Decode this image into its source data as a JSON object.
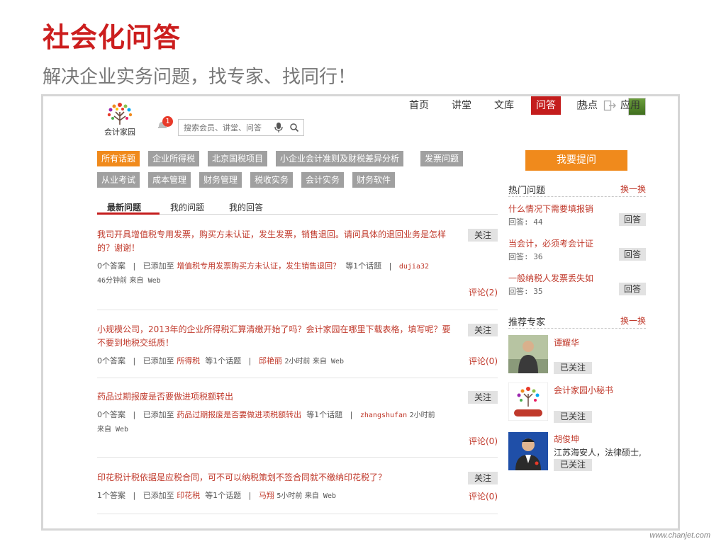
{
  "slide": {
    "title": "社会化问答",
    "subtitle": "解决企业实务问题，找专家、找同行！",
    "footer_url": "www.chanjet.com"
  },
  "header": {
    "logo_text": "会计家园",
    "notification_count": "1",
    "search_placeholder": "搜索会员、讲堂、问答",
    "nav": [
      "首页",
      "讲堂",
      "文库",
      "问答",
      "热点",
      "应用"
    ],
    "active_nav": "问答"
  },
  "topic_tags": {
    "row1": [
      "所有话题",
      "企业所得税",
      "北京国税项目",
      "小企业会计准则及财税差异分析",
      "发票问题"
    ],
    "row2": [
      "从业考试",
      "成本管理",
      "财务管理",
      "税收实务",
      "会计实务",
      "财务软件"
    ],
    "active": "所有话题"
  },
  "tabs": [
    "最新问题",
    "我的问题",
    "我的回答"
  ],
  "questions": [
    {
      "title": "我司开具增值税专用发票，购买方未认证，发生发票，销售退回。请问具体的退回业务是怎样的？谢谢！",
      "follow": "关注",
      "answers": "0个答案",
      "added_to": "已添加至",
      "topic": "增值税专用发票购买方未认证，发生销售退回？",
      "topic_count": "等1个话题",
      "user": "dujia32",
      "time": "46分钟前",
      "source": "来自 Web",
      "comment": "评论(2)"
    },
    {
      "title": "小规模公司，2013年的企业所得税汇算清缴开始了吗？会计家园在哪里下载表格，填写呢？要不要到地税交纸质！",
      "follow": "关注",
      "answers": "0个答案",
      "added_to": "已添加至",
      "topic": "所得税",
      "topic_count": "等1个话题",
      "user": "邱艳丽",
      "time": "2小时前",
      "source": "来自 Web",
      "comment": "评论(0)"
    },
    {
      "title": "药品过期报废是否要做进项税额转出",
      "follow": "关注",
      "answers": "0个答案",
      "added_to": "已添加至",
      "topic": "药品过期报废是否要做进项税额转出",
      "topic_count": "等1个话题",
      "user": "zhangshufan",
      "time": "2小时前",
      "source": "来自 Web",
      "comment": "评论(0)"
    },
    {
      "title": "印花税计税依据是应税合同，可不可以纳税策划不签合同就不缴纳印花税了？",
      "follow": "关注",
      "answers": "1个答案",
      "added_to": "已添加至",
      "topic": "印花税",
      "topic_count": "等1个话题",
      "user": "马翔",
      "time": "5小时前",
      "source": "来自 Web",
      "comment": "评论(0)"
    }
  ],
  "sidebar": {
    "ask_button": "我要提问",
    "hot": {
      "heading": "热门问题",
      "change": "换一换",
      "items": [
        {
          "title": "什么情况下需要填报销",
          "count": "回答: 44",
          "action": "回答"
        },
        {
          "title": "当会计，必须考会计证",
          "count": "回答: 36",
          "action": "回答"
        },
        {
          "title": "一般纳税人发票丢失如",
          "count": "回答: 35",
          "action": "回答"
        }
      ]
    },
    "experts": {
      "heading": "推荐专家",
      "change": "换一换",
      "items": [
        {
          "name": "谭耀华",
          "desc": "",
          "status": "已关注"
        },
        {
          "name": "会计家园小秘书",
          "desc": "",
          "status": "已关注"
        },
        {
          "name": "胡俊坤",
          "desc": "江苏海安人，法律硕士,",
          "status": "已关注"
        }
      ]
    }
  },
  "colors": {
    "title_red": "#cc1e1e",
    "link_red": "#c0392b",
    "orange": "#f08a1c",
    "nav_active": "#c41d1d",
    "tag_gray": "#a0a0a0"
  }
}
